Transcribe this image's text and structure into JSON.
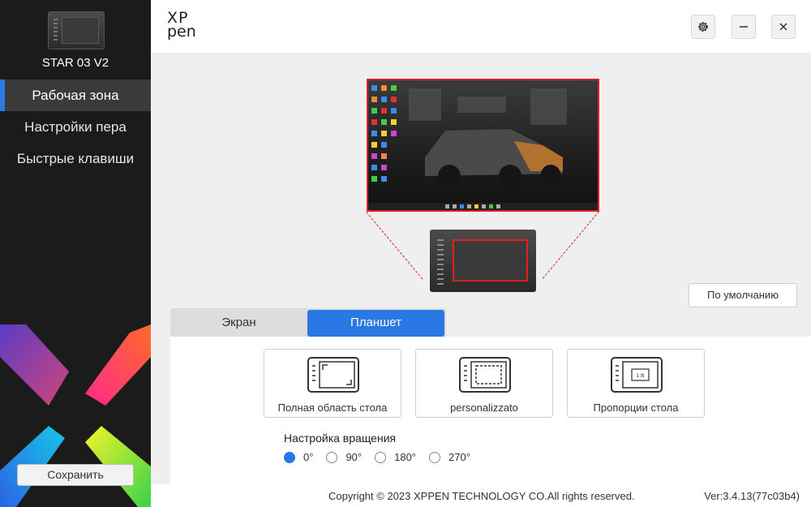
{
  "sidebar": {
    "device_name": "STAR 03 V2",
    "items": [
      {
        "label": "Рабочая зона",
        "active": true
      },
      {
        "label": "Настройки пера",
        "active": false
      },
      {
        "label": "Быстрые клавиши",
        "active": false
      }
    ],
    "save_label": "Сохранить"
  },
  "header": {
    "logo_line1": "XP",
    "logo_line2": "pen",
    "icons": [
      "gear-icon",
      "minimize-icon",
      "close-icon"
    ]
  },
  "main": {
    "default_label": "По умолчанию",
    "tabs": [
      {
        "label": "Экран",
        "selected": false
      },
      {
        "label": "Планшет",
        "selected": true
      }
    ],
    "area_options": [
      {
        "label": "Полная область стола",
        "icon": "full-area-icon"
      },
      {
        "label": "personalizzato",
        "icon": "custom-area-icon"
      },
      {
        "label": "Пропорции стола",
        "icon": "ratio-area-icon",
        "icon_text": "1:N"
      }
    ],
    "rotation": {
      "title": "Настройка вращения",
      "options": [
        "0°",
        "90°",
        "180°",
        "270°"
      ],
      "selected": "0°"
    }
  },
  "footer": {
    "copyright": "Copyright © 2023  XPPEN TECHNOLOGY CO.All rights reserved.",
    "version": "Ver:3.4.13(77c03b4)"
  },
  "colors": {
    "accent": "#2a78e4",
    "mapping_outline": "#e02020",
    "sidebar_bg": "#1b1b1b"
  }
}
